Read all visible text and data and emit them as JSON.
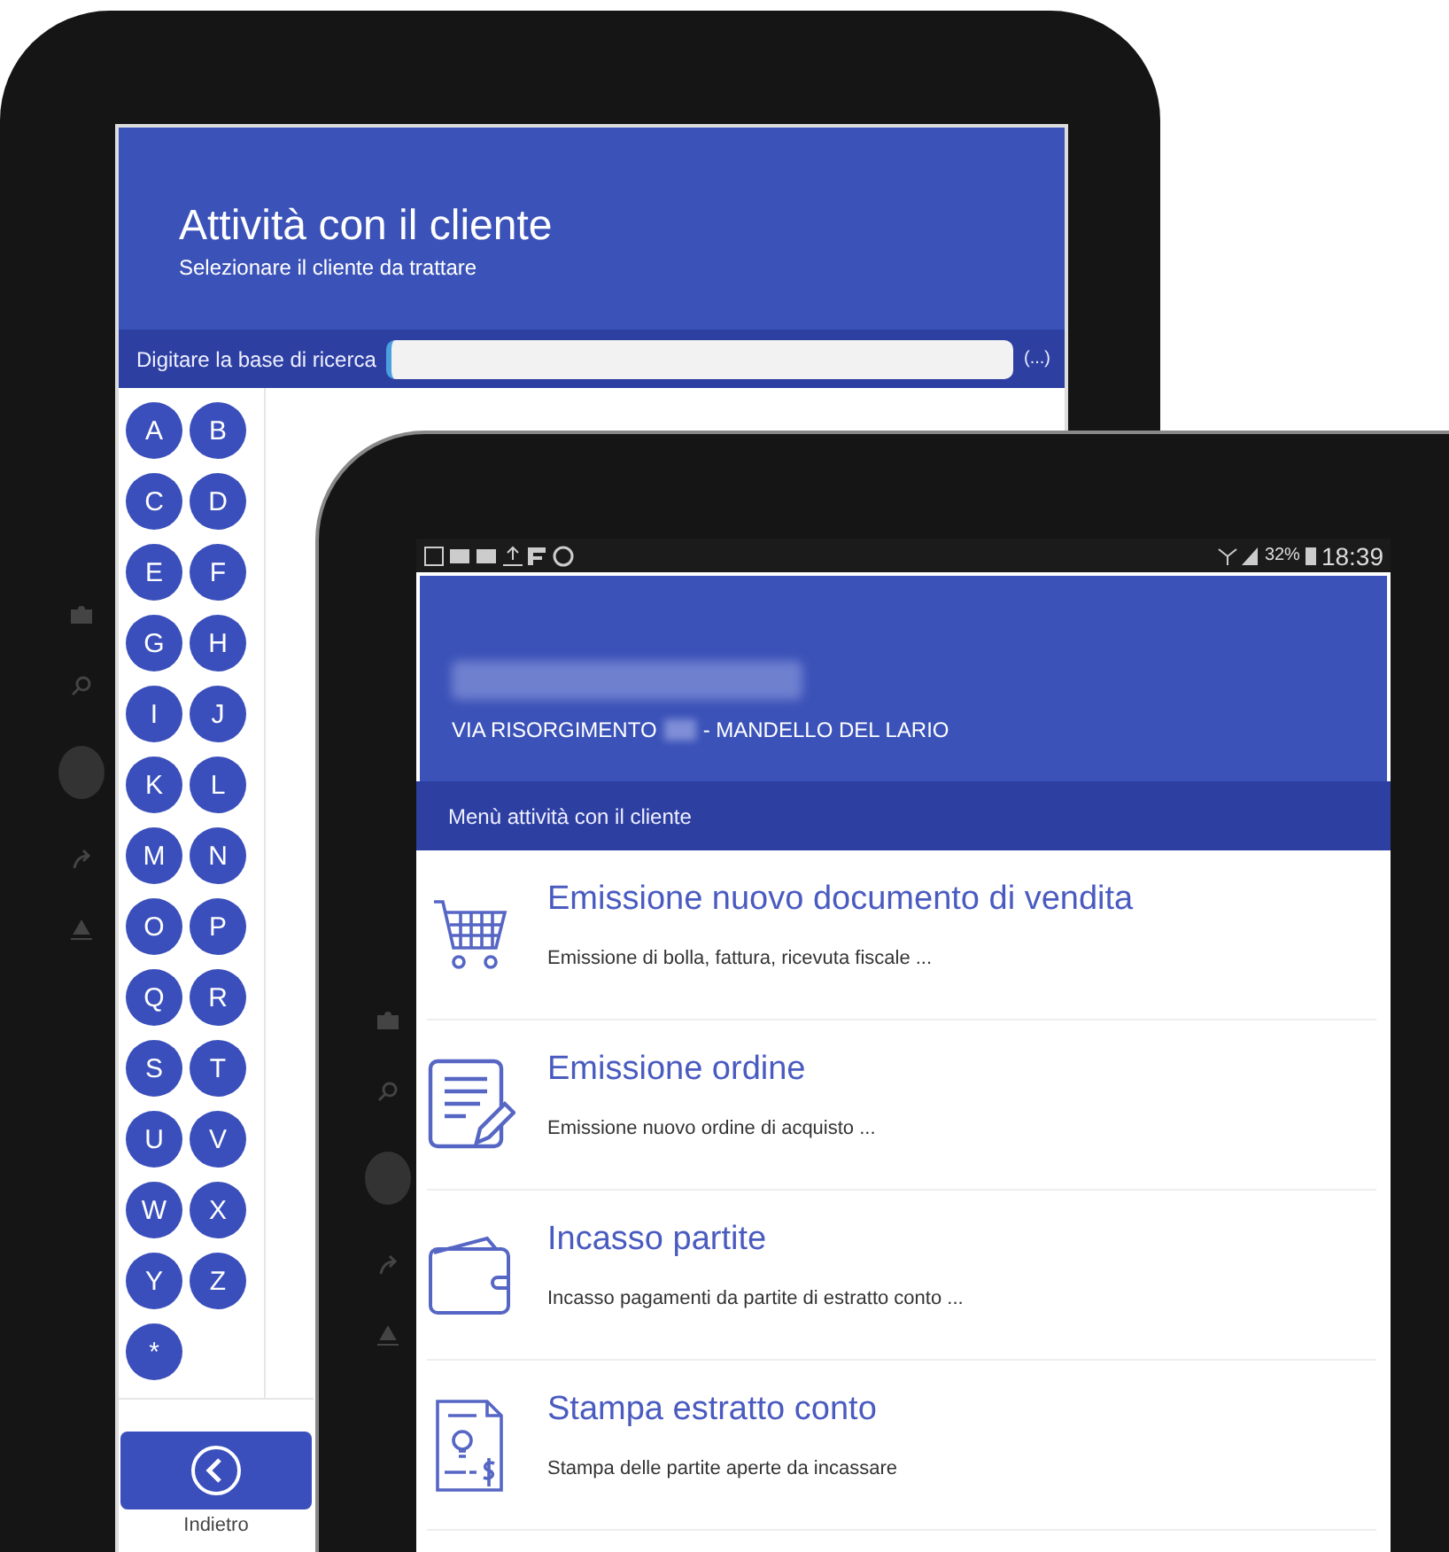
{
  "back_tablet": {
    "header": {
      "title": "Attività con il cliente",
      "subtitle": "Selezionare il cliente da trattare"
    },
    "search": {
      "label": "Digitare la base di ricerca",
      "more": "(...)"
    },
    "letters": [
      "A",
      "B",
      "C",
      "D",
      "E",
      "F",
      "G",
      "H",
      "I",
      "J",
      "K",
      "L",
      "M",
      "N",
      "O",
      "P",
      "Q",
      "R",
      "S",
      "T",
      "U",
      "V",
      "W",
      "X",
      "Y",
      "Z",
      "*"
    ],
    "back_button": {
      "label": "Indietro"
    }
  },
  "front_tablet": {
    "status_bar": {
      "battery": "32%",
      "time": "18:39"
    },
    "customer": {
      "address_street": "VIA RISORGIMENTO",
      "address_city": "- MANDELLO DEL LARIO"
    },
    "section_title": "Menù attività con il cliente",
    "menu": [
      {
        "kind": "cart",
        "title": "Emissione nuovo documento di vendita",
        "description": "Emissione di bolla, fattura, ricevuta fiscale ..."
      },
      {
        "kind": "order",
        "title": "Emissione ordine",
        "description": "Emissione nuovo ordine di acquisto ..."
      },
      {
        "kind": "wallet",
        "title": "Incasso partite",
        "description": "Incasso pagamenti da partite di estratto conto ..."
      },
      {
        "kind": "statement",
        "title": "Stampa estratto conto",
        "description": "Stampa delle partite aperte da incassare"
      }
    ]
  }
}
